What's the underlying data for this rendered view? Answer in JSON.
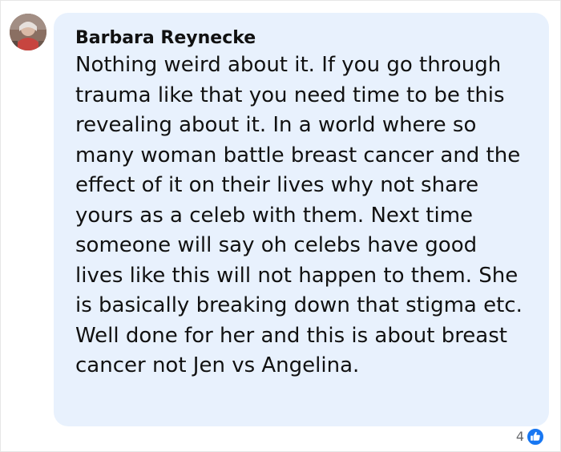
{
  "comment": {
    "author": "Barbara Reynecke",
    "text": "Nothing weird about it. If you go through trauma like that you need time to be this revealing about it. In a world where so many woman battle breast cancer and the effect of it on their lives why not share yours as a celeb with them. Next time someone will say oh celebs have good lives like this will not happen to them. She is basically breaking down that stigma etc. Well done for her and this is about breast cancer not Jen vs Angelina.",
    "reactions": {
      "count": "4",
      "icon": "like-icon"
    }
  },
  "colors": {
    "bubble_background": "#e8f1fd",
    "text": "#111111",
    "like_blue": "#1877f2",
    "muted": "#65676b"
  }
}
